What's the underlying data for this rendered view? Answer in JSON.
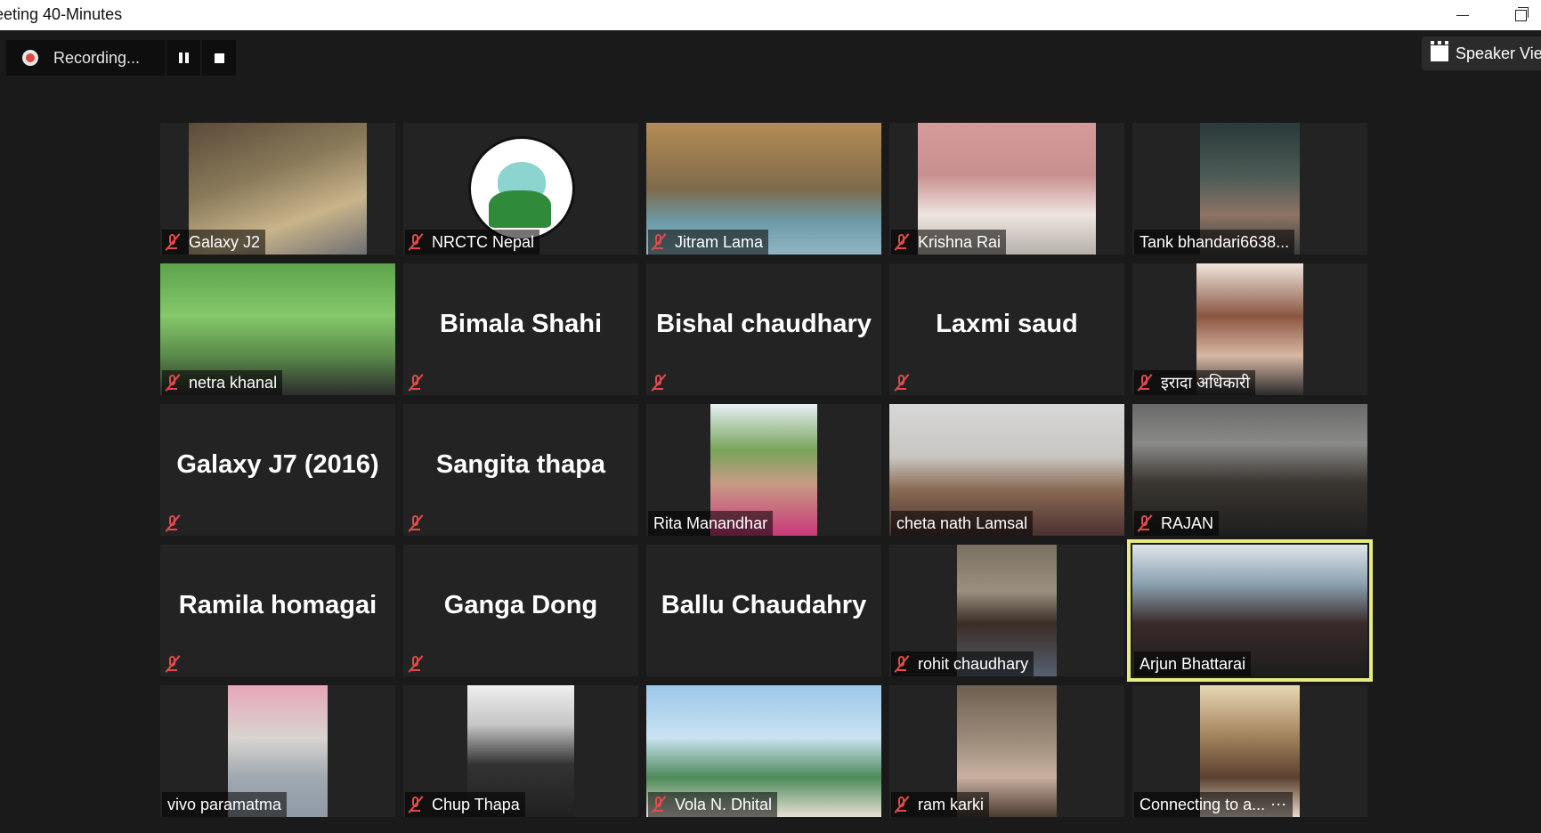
{
  "window": {
    "title": "eeting 40-Minutes"
  },
  "recording": {
    "status_label": "Recording..."
  },
  "view_toggle": {
    "label": "Speaker Vie"
  },
  "participants": [
    {
      "name": "Galaxy J2",
      "muted": true,
      "video": true
    },
    {
      "name": "NRCTC Nepal",
      "muted": true,
      "video": true
    },
    {
      "name": "Jitram Lama",
      "muted": true,
      "video": true
    },
    {
      "name": "Krishna Rai",
      "muted": true,
      "video": true
    },
    {
      "name": "Tank bhandari6638...",
      "muted": false,
      "video": true
    },
    {
      "name": "netra khanal",
      "muted": true,
      "video": true
    },
    {
      "name": "Bimala Shahi",
      "muted": true,
      "video": false
    },
    {
      "name": "Bishal chaudhary",
      "muted": true,
      "video": false
    },
    {
      "name": "Laxmi saud",
      "muted": true,
      "video": false
    },
    {
      "name": "इरादा अधिकारी",
      "muted": true,
      "video": true
    },
    {
      "name": "Galaxy J7 (2016)",
      "muted": true,
      "video": false
    },
    {
      "name": "Sangita thapa",
      "muted": true,
      "video": false
    },
    {
      "name": "Rita Manandhar",
      "muted": false,
      "video": true
    },
    {
      "name": "cheta nath Lamsal",
      "muted": false,
      "video": true
    },
    {
      "name": "RAJAN",
      "muted": true,
      "video": true
    },
    {
      "name": "Ramila homagai",
      "muted": true,
      "video": false
    },
    {
      "name": "Ganga Dong",
      "muted": true,
      "video": false
    },
    {
      "name": "Ballu Chaudahry",
      "muted": false,
      "video": false
    },
    {
      "name": "rohit chaudhary",
      "muted": true,
      "video": true
    },
    {
      "name": "Arjun Bhattarai",
      "muted": false,
      "video": true,
      "active_speaker": true
    },
    {
      "name": "vivo paramatma",
      "muted": false,
      "video": true
    },
    {
      "name": "Chup Thapa",
      "muted": true,
      "video": true
    },
    {
      "name": "Vola N. Dhital",
      "muted": true,
      "video": true
    },
    {
      "name": "ram karki",
      "muted": true,
      "video": true
    },
    {
      "name": "Connecting to a...",
      "muted": false,
      "video": true,
      "connecting_icon": "more-dots-icon"
    }
  ],
  "colors": {
    "background": "#1a1a1a",
    "tile": "#232323",
    "mute_red": "#e04b4b",
    "active_border": "#e8eb7e",
    "record_red": "#e0453f"
  }
}
